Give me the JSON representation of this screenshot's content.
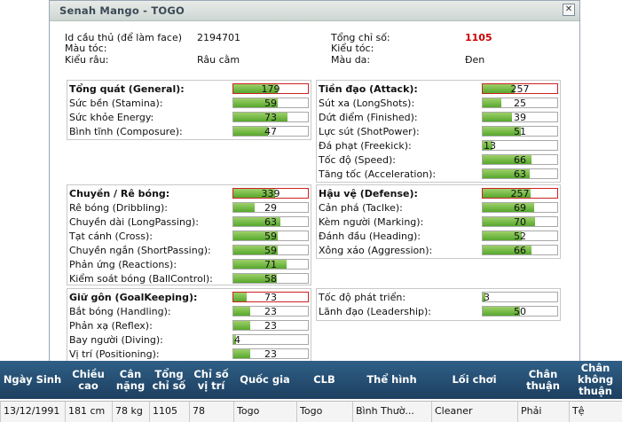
{
  "dialog": {
    "title": "Senah Mango - TOGO",
    "close_glyph": "✕"
  },
  "info": {
    "id_label": "Id cầu thủ (để làm face)",
    "id_value": "2194701",
    "hair_color_label": "Màu tóc:",
    "beard_label": "Kiểu râu:",
    "beard_value": "Râu cằm",
    "total_label": "Tổng chỉ số:",
    "total_value": "1105",
    "hair_style_label": "Kiểu tóc:",
    "skin_label": "Màu da:",
    "skin_value": "Đen"
  },
  "panels": {
    "general": {
      "title": "Tổng quát (General):",
      "total": 179,
      "rows": [
        {
          "label": "Sức bền (Stamina):",
          "value": 59
        },
        {
          "label": "Sức khỏe Energy:",
          "value": 73
        },
        {
          "label": "Bình tĩnh (Composure):",
          "value": 47
        }
      ]
    },
    "attack": {
      "title": "Tiền đạo (Attack):",
      "total": 257,
      "rows": [
        {
          "label": "Sút xa (LongShots):",
          "value": 25
        },
        {
          "label": "Dứt điểm (Finished):",
          "value": 39
        },
        {
          "label": "Lực sút (ShotPower):",
          "value": 51
        },
        {
          "label": "Đá phạt (Freekick):",
          "value": 13
        },
        {
          "label": "Tốc độ (Speed):",
          "value": 66
        },
        {
          "label": "Tăng tốc (Acceleration):",
          "value": 63
        }
      ]
    },
    "dribbling": {
      "title": "Chuyền / Rê bóng:",
      "total": 339,
      "rows": [
        {
          "label": "Rê bóng (Dribbling):",
          "value": 29
        },
        {
          "label": "Chuyền dài (LongPassing):",
          "value": 63
        },
        {
          "label": "Tạt cánh (Cross):",
          "value": 59
        },
        {
          "label": "Chuyền ngắn (ShortPassing):",
          "value": 59
        },
        {
          "label": "Phản ứng (Reactions):",
          "value": 71
        },
        {
          "label": "Kiểm soát bóng (BallControl):",
          "value": 58
        }
      ]
    },
    "defense": {
      "title": "Hậu vệ (Defense):",
      "total": 257,
      "rows": [
        {
          "label": "Cản phá (Taclke):",
          "value": 69
        },
        {
          "label": "Kèm người (Marking):",
          "value": 70
        },
        {
          "label": "Đánh đầu (Heading):",
          "value": 52
        },
        {
          "label": "Xông xáo (Aggression):",
          "value": 66
        }
      ]
    },
    "goalkeeping": {
      "title": "Giữ gôn (GoalKeeping):",
      "total": 73,
      "rows": [
        {
          "label": "Bắt bóng (Handling):",
          "value": 23
        },
        {
          "label": "Phản xạ (Reflex):",
          "value": 23
        },
        {
          "label": "Bay người (Diving):",
          "value": 4
        },
        {
          "label": "Vị trí (Positioning):",
          "value": 23
        }
      ]
    },
    "misc": {
      "rows": [
        {
          "label": "Tốc độ phát triển:",
          "value": 3
        },
        {
          "label": "Lãnh đạo (Leadership):",
          "value": 50
        }
      ]
    }
  },
  "table": {
    "headers": [
      "Ngày Sinh",
      "Chiều cao",
      "Cân nặng",
      "Tổng chỉ số",
      "Chỉ số vị trí",
      "Quốc gia",
      "CLB",
      "Thể hình",
      "Lối chơi",
      "Chân thuận",
      "Chân không thuận"
    ],
    "row": [
      "13/12/1991",
      "181 cm",
      "78 kg",
      "1105",
      "78",
      "Togo",
      "Togo",
      "Bình Thườ...",
      "Cleaner",
      "Phải",
      "Tệ"
    ]
  },
  "colors": {
    "header_bg": "#2a5478",
    "bar_fill": "#6cbb3c",
    "total_highlight": "#cc0000"
  }
}
